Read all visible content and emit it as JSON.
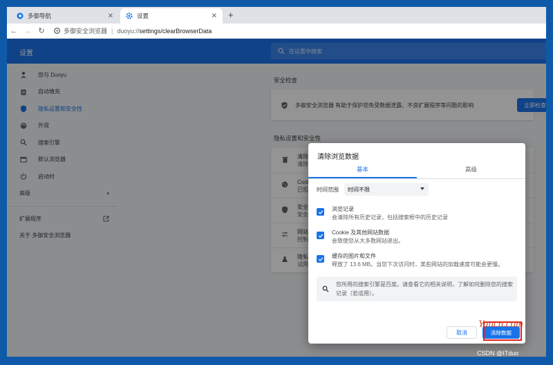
{
  "browser": {
    "tabs": [
      {
        "label": "多御导航",
        "active": false
      },
      {
        "label": "设置",
        "active": true
      }
    ],
    "omnibox": {
      "site_name": "多御安全浏览器",
      "scheme": "duoyu://",
      "path": "settings/clearBrowserData"
    }
  },
  "settings": {
    "title": "设置",
    "search_placeholder": "在设置中搜索",
    "nav": [
      {
        "label": "您与 Duoyu",
        "icon": "person-icon"
      },
      {
        "label": "自动填充",
        "icon": "clipboard-icon"
      },
      {
        "label": "隐私设置和安全性",
        "icon": "shield-icon",
        "active": true
      },
      {
        "label": "外观",
        "icon": "palette-icon"
      },
      {
        "label": "搜索引擎",
        "icon": "search-icon"
      },
      {
        "label": "默认浏览器",
        "icon": "browser-icon"
      },
      {
        "label": "启动时",
        "icon": "power-icon"
      }
    ],
    "advanced_label": "高级",
    "extensions_label": "扩展程序",
    "about_label": "关于 多御安全浏览器",
    "safety_check": {
      "title": "安全检查",
      "text": "多御安全浏览器 有助于保护您免受数据泄露、不良扩展程序等问题的影响",
      "button": "立即检查"
    },
    "privacy": {
      "title": "隐私设置和安全性",
      "rows": [
        {
          "icon": "trash-icon",
          "title": "清除",
          "sub": "清除"
        },
        {
          "icon": "cookie-icon",
          "title": "Cook",
          "sub": "已阻"
        },
        {
          "icon": "shield-icon",
          "title": "安全",
          "sub": "安全"
        },
        {
          "icon": "sliders-icon",
          "title": "网站",
          "sub": "控制"
        },
        {
          "icon": "flask-icon",
          "title": "隐私",
          "sub": "试用"
        }
      ]
    }
  },
  "dialog": {
    "title": "清除浏览数据",
    "tabs": [
      "基本",
      "高级"
    ],
    "selected_tab": "基本",
    "time_range_label": "时间范围",
    "time_range_value": "时间不限",
    "options": [
      {
        "title": "浏览记录",
        "sub": "会清除所有历史记录，包括搜索框中的历史记录",
        "checked": true
      },
      {
        "title": "Cookie 及其他网站数据",
        "sub": "会致使您从大多数网站退出。",
        "checked": true
      },
      {
        "title": "缓存的图片和文件",
        "sub": "释放了 13.6 MB。当您下次访问时，某些网站的加载速度可能会更慢。",
        "checked": true
      }
    ],
    "note": "您所用的搜索引擎是百度。请查看它的相关说明，了解如何删除您的搜索记录（若适用）。",
    "cancel": "取消",
    "clear": "清除数据"
  },
  "watermarks": {
    "yuucn": "Yuucn.com",
    "csdn": "CSDN @ITduo"
  },
  "colors": {
    "accent": "#1a73e8",
    "frame": "#0f5aa8",
    "highlight_box": "#e0201c"
  }
}
